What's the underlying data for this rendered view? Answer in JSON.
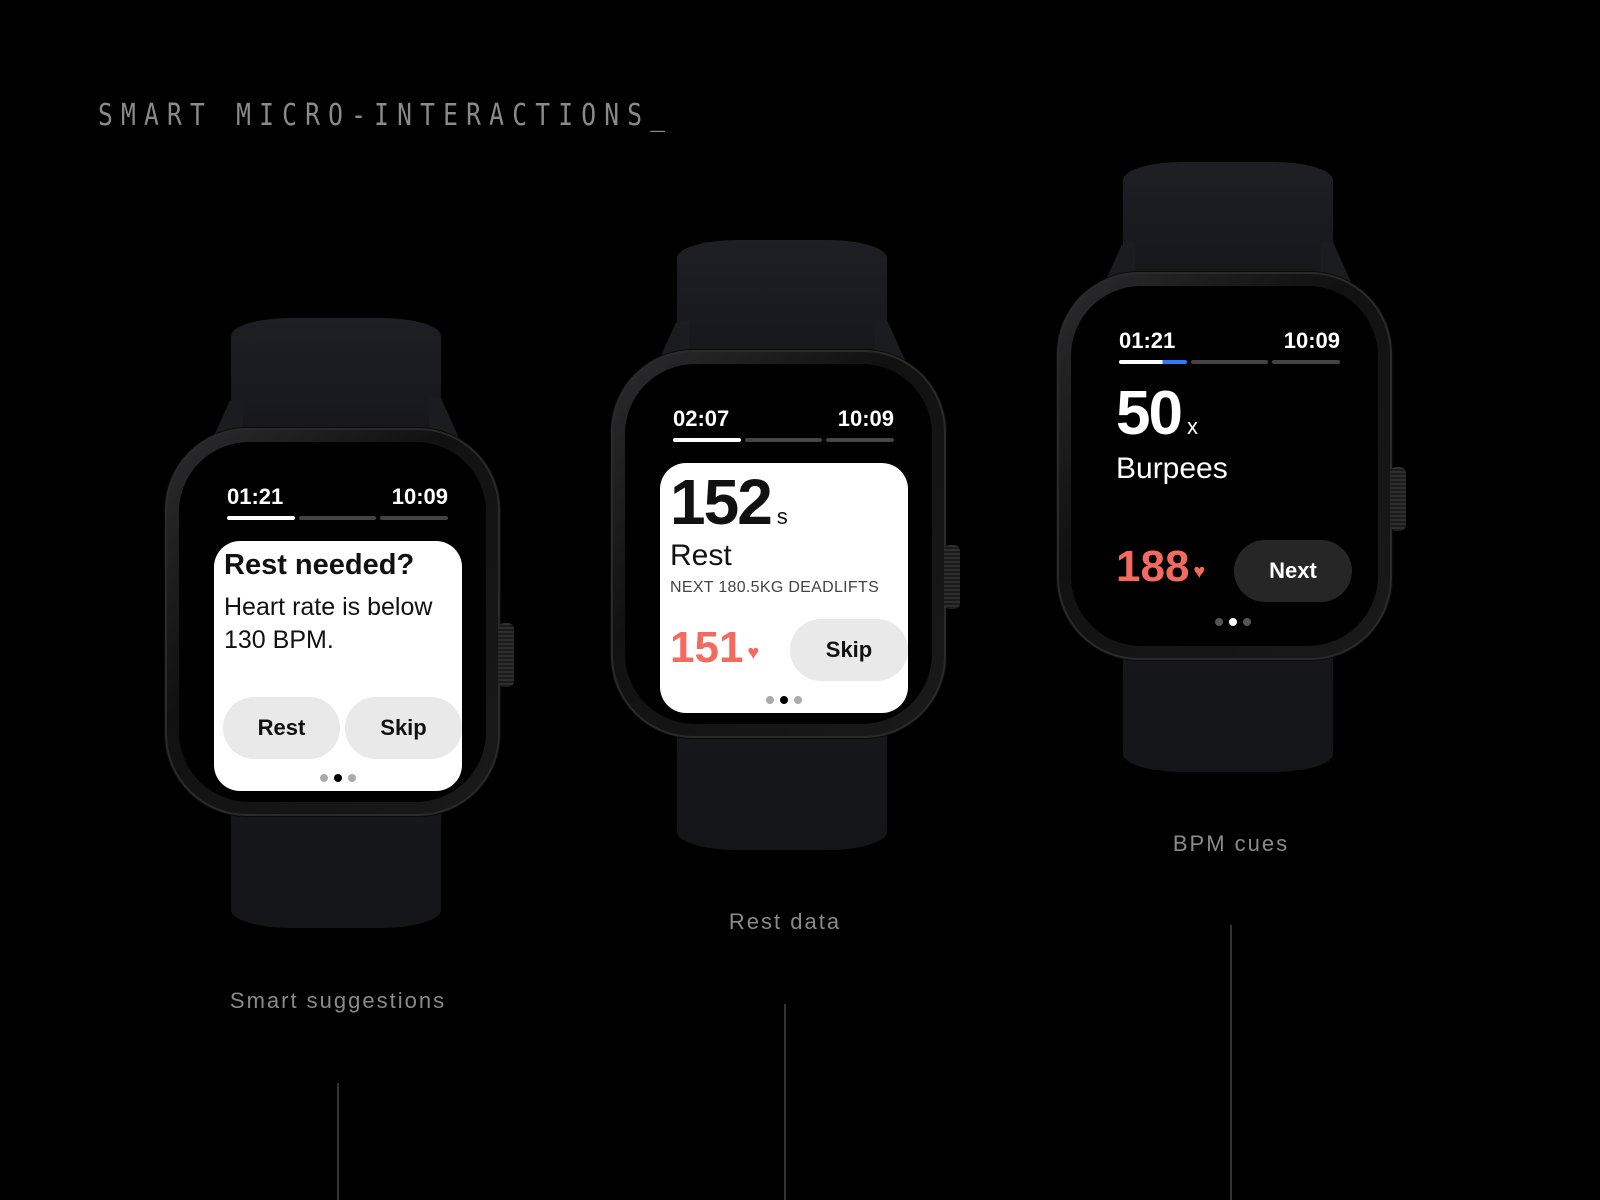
{
  "title": "SMART MICRO-INTERACTIONS_",
  "watches": [
    {
      "caption": "Smart suggestions",
      "status": {
        "elapsed": "01:21",
        "clock": "10:09"
      },
      "card": {
        "heading": "Rest needed?",
        "body": "Heart rate is below 130 BPM.",
        "buttons": [
          "Rest",
          "Skip"
        ]
      },
      "page_indicator": {
        "count": 3,
        "active": 2
      }
    },
    {
      "caption": "Rest data",
      "status": {
        "elapsed": "02:07",
        "clock": "10:09"
      },
      "card": {
        "value": "152",
        "unit": "s",
        "label": "Rest",
        "next": "NEXT 180.5KG DEADLIFTS",
        "bpm": "151",
        "button": "Skip"
      },
      "page_indicator": {
        "count": 3,
        "active": 2
      }
    },
    {
      "caption": "BPM cues",
      "status": {
        "elapsed": "01:21",
        "clock": "10:09"
      },
      "card": {
        "value": "50",
        "unit": "x",
        "label": "Burpees",
        "bpm": "188",
        "button": "Next"
      },
      "page_indicator": {
        "count": 3,
        "active": 2
      }
    }
  ],
  "colors": {
    "heart_rate": "#f26b5e",
    "progress_accent": "#2f7bf5",
    "caption": "#8a8a8a"
  }
}
